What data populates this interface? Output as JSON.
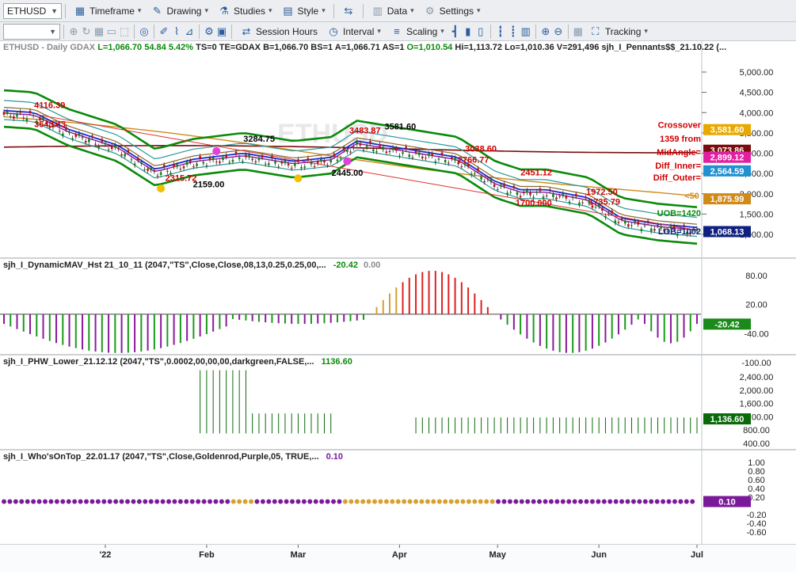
{
  "toolbar1": {
    "symbol": "ETHUSD",
    "timeframe": "Timeframe",
    "drawing": "Drawing",
    "studies": "Studies",
    "style": "Style",
    "data": "Data",
    "settings": "Settings"
  },
  "toolbar2": {
    "session_hours": "Session Hours",
    "interval": "Interval",
    "scaling": "Scaling",
    "tracking": "Tracking"
  },
  "header": {
    "symbol_line": "ETHUSD - Daily  GDAX",
    "L": "L=1,066.70",
    "chg": "54.84",
    "pct": "5.42%",
    "rest": "TS=0  TE=GDAX  B=1,066.70  BS=1  A=1,066.71  AS=1",
    "O": "O=1,010.54",
    "hilo": "Hi=1,113.72  Lo=1,010.36  V=291,496  sjh_I_Pennants$$_21.10.22 (..."
  },
  "watermark": "ETHUSD",
  "price_pane": {
    "axis_ticks": [
      "5,000.00",
      "4,500.00",
      "4,000.00",
      "3,500.00",
      "3,000.00",
      "2,500.00",
      "2,000.00",
      "1,500.00",
      "1,000.00"
    ],
    "axis_tick_values": [
      5000,
      4500,
      4000,
      3500,
      3000,
      2500,
      2000,
      1500,
      1000
    ],
    "badges": [
      {
        "text": "3,581.60",
        "color": "#e8a800",
        "value": 3581.6
      },
      {
        "text": "3,073.86",
        "color": "#7a0c0c",
        "value": 3073.86
      },
      {
        "text": "2,899.12",
        "color": "#e020a0",
        "value": 2899.12
      },
      {
        "text": "2,564.59",
        "color": "#2090d0",
        "value": 2564.59
      },
      {
        "text": "1,875.99",
        "color": "#d08a1a",
        "value": 1875.99
      },
      {
        "text": "1,068.13",
        "color": "#102080",
        "value": 1068.13
      }
    ],
    "labels": [
      {
        "text": "4116.39",
        "color": "#d00000",
        "value": 4116.39,
        "day": 12
      },
      {
        "text": "3643.43",
        "color": "#d00000",
        "value": 3643.43,
        "day": 12
      },
      {
        "text": "2315.72",
        "color": "#d00000",
        "value": 2315.72,
        "day": 64
      },
      {
        "text": "2159.00",
        "color": "#000000",
        "value": 2159.0,
        "day": 75
      },
      {
        "text": "3284.75",
        "color": "#000000",
        "value": 3284.75,
        "day": 95
      },
      {
        "text": "2445.00",
        "color": "#000000",
        "value": 2445.0,
        "day": 130
      },
      {
        "text": "3483.87",
        "color": "#d00000",
        "value": 3483.87,
        "day": 137
      },
      {
        "text": "3581.60",
        "color": "#000000",
        "value": 3581.6,
        "day": 151
      },
      {
        "text": "3038.60",
        "color": "#d00000",
        "value": 3038.6,
        "day": 183
      },
      {
        "text": "2766.77",
        "color": "#d00000",
        "value": 2766.77,
        "day": 180
      },
      {
        "text": "2451.12",
        "color": "#d00000",
        "value": 2451.12,
        "day": 205
      },
      {
        "text": "1700.000",
        "color": "#d00000",
        "value": 1700.0,
        "day": 203
      },
      {
        "text": "1972.50",
        "color": "#d00000",
        "value": 1972.5,
        "day": 231
      },
      {
        "text": "1735.79",
        "color": "#d00000",
        "value": 1735.79,
        "day": 232
      },
      {
        "text": "<50",
        "color": "#d08a1a",
        "value": 1875.99,
        "day": 270
      }
    ],
    "side_text": [
      {
        "text": "Crossover",
        "color": "#d00000",
        "value": 3620
      },
      {
        "text": "1359 from",
        "color": "#d00000",
        "value": 3280
      },
      {
        "text": "MidAngle=",
        "color": "#d00000",
        "value": 2950
      },
      {
        "text": "Diff_Inner=",
        "color": "#d00000",
        "value": 2620
      },
      {
        "text": "Diff_Outer=",
        "color": "#d00000",
        "value": 2330
      },
      {
        "text": "UOB=1420",
        "color": "#0a8a0a",
        "value": 1450
      },
      {
        "text": "LOB=1002",
        "color": "#102080",
        "value": 1000
      }
    ]
  },
  "time_axis": [
    "'22",
    "Feb",
    "Mar",
    "Apr",
    "May",
    "Jun",
    "Jul"
  ],
  "time_axis_days": [
    31,
    62,
    90,
    121,
    151,
    182,
    212
  ],
  "panes": {
    "mav": {
      "title": "sjh_I_DynamicMAV_Hst 21_10_11 (2047,\"TS\",Close,Close,08,13,0.25,0.25,00,...",
      "value1": "-20.42",
      "value2": "0.00",
      "axis_ticks": [
        "80.00",
        "20.00",
        "-40.00",
        "-100.00"
      ],
      "axis_tick_values": [
        80,
        20,
        -40,
        -100
      ],
      "badge": "-20.42",
      "badge_value": -20.42
    },
    "phw": {
      "title": "sjh_I_PHW_Lower_21.12.12 (2047,\"TS\",0.0002,00,00,00,darkgreen,FALSE,...",
      "value1": "1136.60",
      "axis_ticks": [
        "2,400.00",
        "2,000.00",
        "1,600.00",
        "1,200.00",
        "800.00",
        "400.00"
      ],
      "axis_tick_values": [
        2400,
        2000,
        1600,
        1200,
        800,
        400
      ],
      "badge": "1,136.60",
      "badge_value": 1136.6
    },
    "wot": {
      "title": "sjh_I_Who'sOnTop_22.01.17 (2047,\"TS\",Close,Goldenrod,Purple,05, TRUE,...",
      "value1": "0.10",
      "axis_ticks": [
        "1.00",
        "0.80",
        "0.60",
        "0.40",
        "0.20",
        "-0.20",
        "-0.40",
        "-0.60"
      ],
      "axis_tick_values": [
        1.0,
        0.8,
        0.6,
        0.4,
        0.2,
        -0.2,
        -0.4,
        -0.6
      ],
      "badge": "0.10",
      "badge_value": 0.1
    }
  },
  "colors": {
    "green_band": "#0a8a0a",
    "purple_hist": "#8a1a9a",
    "green_hist": "#1a9a1a",
    "red_hist": "#e02020",
    "gold_hist": "#d8a030",
    "mav_badge": "#1a8a1a",
    "phw_badge": "#0a6a0a",
    "wot_badge": "#7a1a9a"
  }
}
